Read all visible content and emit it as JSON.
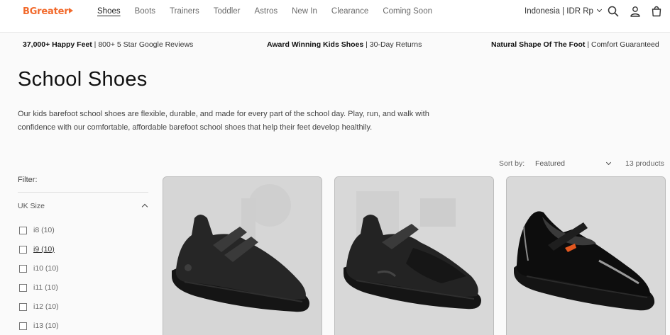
{
  "header": {
    "logo": "BGreater",
    "nav": [
      "Shoes",
      "Boots",
      "Trainers",
      "Toddler",
      "Astros",
      "New In",
      "Clearance",
      "Coming Soon"
    ],
    "active_nav": "Shoes",
    "country": "Indonesia | IDR Rp",
    "icons": [
      "search-icon",
      "account-icon",
      "cart-icon"
    ]
  },
  "announcement": [
    {
      "bold": "37,000+ Happy Feet",
      "rest": " | 800+ 5 Star Google Reviews"
    },
    {
      "bold": "Award Winning Kids Shoes",
      "rest": " | 30-Day Returns"
    },
    {
      "bold": "Natural Shape Of The Foot",
      "rest": " | Comfort Guaranteed"
    }
  ],
  "page": {
    "title": "School Shoes",
    "description": "Our kids barefoot school shoes are flexible, durable, and made for every part of the school day. Play, run, and walk with confidence with our comfortable, affordable barefoot school shoes that help their feet develop healthily."
  },
  "sort": {
    "label": "Sort by:",
    "selected": "Featured",
    "count": "13 products"
  },
  "filter": {
    "label": "Filter:",
    "group": "UK Size",
    "options": [
      {
        "label": "i8 (10)"
      },
      {
        "label": "i9 (10)"
      },
      {
        "label": "i10 (10)"
      },
      {
        "label": "i11 (10)"
      },
      {
        "label": "i12 (10)"
      },
      {
        "label": "i13 (10)"
      }
    ]
  },
  "colors": {
    "brand": "#f26a2c",
    "card_bg": "#d9d9d9",
    "shoe": "#1c1c1c"
  }
}
